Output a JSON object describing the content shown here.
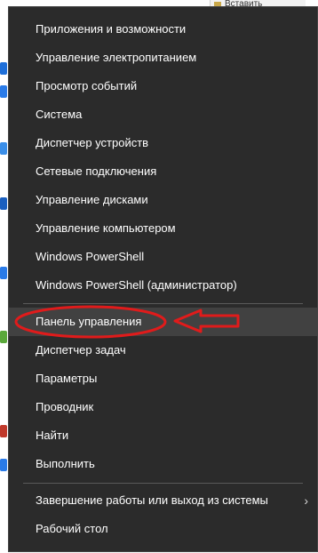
{
  "desktop": {
    "top_hint": "Вставить",
    "icon_colors": [
      "#1e6fd9",
      "#2a7be8",
      "#3a8ee8",
      "#1a5fbf",
      "#2a7be8",
      "#5aa83a",
      "#c0392b",
      "#2a7be8"
    ]
  },
  "menu": {
    "group1": [
      "Приложения и возможности",
      "Управление электропитанием",
      "Просмотр событий",
      "Система",
      "Диспетчер устройств",
      "Сетевые подключения",
      "Управление дисками",
      "Управление компьютером",
      "Windows PowerShell",
      "Windows PowerShell (администратор)"
    ],
    "group2": [
      "Панель управления",
      "Диспетчер задач",
      "Параметры",
      "Проводник",
      "Найти",
      "Выполнить"
    ],
    "group3": [
      "Завершение работы или выход из системы",
      "Рабочий стол"
    ],
    "highlighted": "Панель управления",
    "submenu_chevron": "›"
  },
  "colors": {
    "menu_bg": "#2b2b2b",
    "highlight_bg": "#414141",
    "annotation_red": "#e01b1b"
  }
}
